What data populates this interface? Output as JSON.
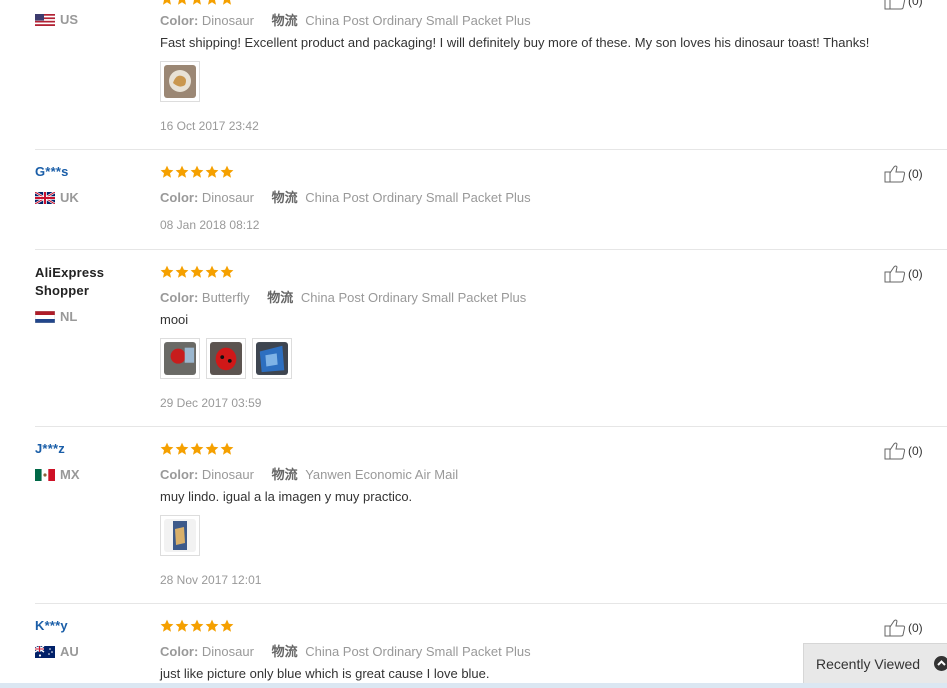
{
  "labels": {
    "color_key": "Color:",
    "shipping_mark": "物流"
  },
  "reviews": [
    {
      "user": "",
      "country": "US",
      "color": "Dinosaur",
      "shipping": "China Post Ordinary Small Packet Plus",
      "text": "Fast shipping! Excellent product and packaging! I will definitely buy more of these. My son loves his dinosaur toast! Thanks!",
      "date": "16 Oct 2017 23:42",
      "likes": "(0)",
      "rating": 5
    },
    {
      "user": "G***s",
      "country": "UK",
      "color": "Dinosaur",
      "shipping": "China Post Ordinary Small Packet Plus",
      "text": "",
      "date": "08 Jan 2018 08:12",
      "likes": "(0)",
      "rating": 5
    },
    {
      "user": "AliExpress Shopper",
      "country": "NL",
      "color": "Butterfly",
      "shipping": "China Post Ordinary Small Packet Plus",
      "text": "mooi",
      "date": "29 Dec 2017 03:59",
      "likes": "(0)",
      "rating": 5
    },
    {
      "user": "J***z",
      "country": "MX",
      "color": "Dinosaur",
      "shipping": "Yanwen Economic Air Mail",
      "text": "muy lindo. igual a la imagen y muy practico.",
      "date": "28 Nov 2017 12:01",
      "likes": "(0)",
      "rating": 5
    },
    {
      "user": "K***y",
      "country": "AU",
      "color": "Dinosaur",
      "shipping": "China Post Ordinary Small Packet Plus",
      "text": "just like picture only blue which is great cause I love blue.",
      "date": "",
      "likes": "(0)",
      "rating": 5
    }
  ],
  "recently_viewed": "Recently Viewed",
  "colors": {
    "star": "#f5a000",
    "username": "#1a5ea8",
    "muted": "#999999"
  }
}
